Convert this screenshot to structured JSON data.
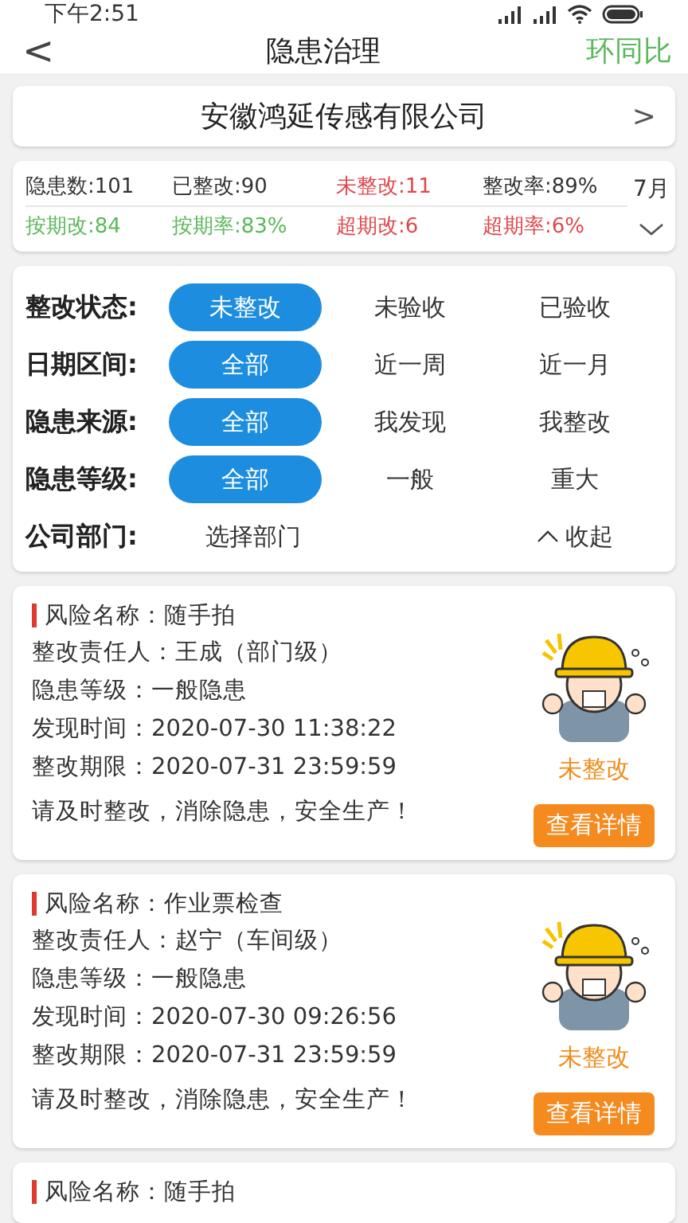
{
  "status_bar": {
    "time": "下午2:51"
  },
  "nav": {
    "back": "<",
    "title": "隐患治理",
    "action": "环同比"
  },
  "company": {
    "name": "安徽鸿延传感有限公司",
    "arrow": ">"
  },
  "stats": {
    "rows": [
      [
        {
          "text": "隐患数:101",
          "color": "#333333"
        },
        {
          "text": "已整改:90",
          "color": "#333333"
        },
        {
          "text": "未整改:11",
          "color": "#e0474c"
        },
        {
          "text": "整改率:89%",
          "color": "#333333"
        }
      ],
      [
        {
          "text": "按期改:84",
          "color": "#5cb85c"
        },
        {
          "text": "按期率:83%",
          "color": "#5cb85c"
        },
        {
          "text": "超期改:6",
          "color": "#e0474c"
        },
        {
          "text": "超期率:6%",
          "color": "#e0474c"
        }
      ]
    ],
    "month": "7月",
    "expanded": false
  },
  "filters": [
    {
      "kind": "options",
      "label": "整改状态:",
      "options": [
        {
          "text": "未整改",
          "selected": true
        },
        {
          "text": "未验收",
          "selected": false
        },
        {
          "text": "已验收",
          "selected": false
        }
      ]
    },
    {
      "kind": "options",
      "label": "日期区间:",
      "options": [
        {
          "text": "全部",
          "selected": true
        },
        {
          "text": "近一周",
          "selected": false
        },
        {
          "text": "近一月",
          "selected": false
        }
      ]
    },
    {
      "kind": "options",
      "label": "隐患来源:",
      "options": [
        {
          "text": "全部",
          "selected": true
        },
        {
          "text": "我发现",
          "selected": false
        },
        {
          "text": "我整改",
          "selected": false
        }
      ]
    },
    {
      "kind": "options",
      "label": "隐患等级:",
      "options": [
        {
          "text": "全部",
          "selected": true
        },
        {
          "text": "一般",
          "selected": false
        },
        {
          "text": "重大",
          "selected": false
        }
      ]
    },
    {
      "kind": "department",
      "label": "公司部门:",
      "value": "选择部门",
      "toggle": "收起"
    }
  ],
  "records": [
    {
      "title": "风险名称：随手拍",
      "lines": [
        "整改责任人：王成（部门级）",
        "隐患等级：一般隐患",
        "发现时间：2020-07-30 11:38:22",
        "整改期限：2020-07-31 23:59:59"
      ],
      "note": "请及时整改，消除隐患，安全生产！",
      "status": "未整改",
      "button": "查看详情"
    },
    {
      "title": "风险名称：作业票检查",
      "lines": [
        "整改责任人：赵宁（车间级）",
        "隐患等级：一般隐患",
        "发现时间：2020-07-30 09:26:56",
        "整改期限：2020-07-31 23:59:59"
      ],
      "note": "请及时整改，消除隐患，安全生产！",
      "status": "未整改",
      "button": "查看详情"
    },
    {
      "title": "风险名称：随手拍"
    }
  ]
}
